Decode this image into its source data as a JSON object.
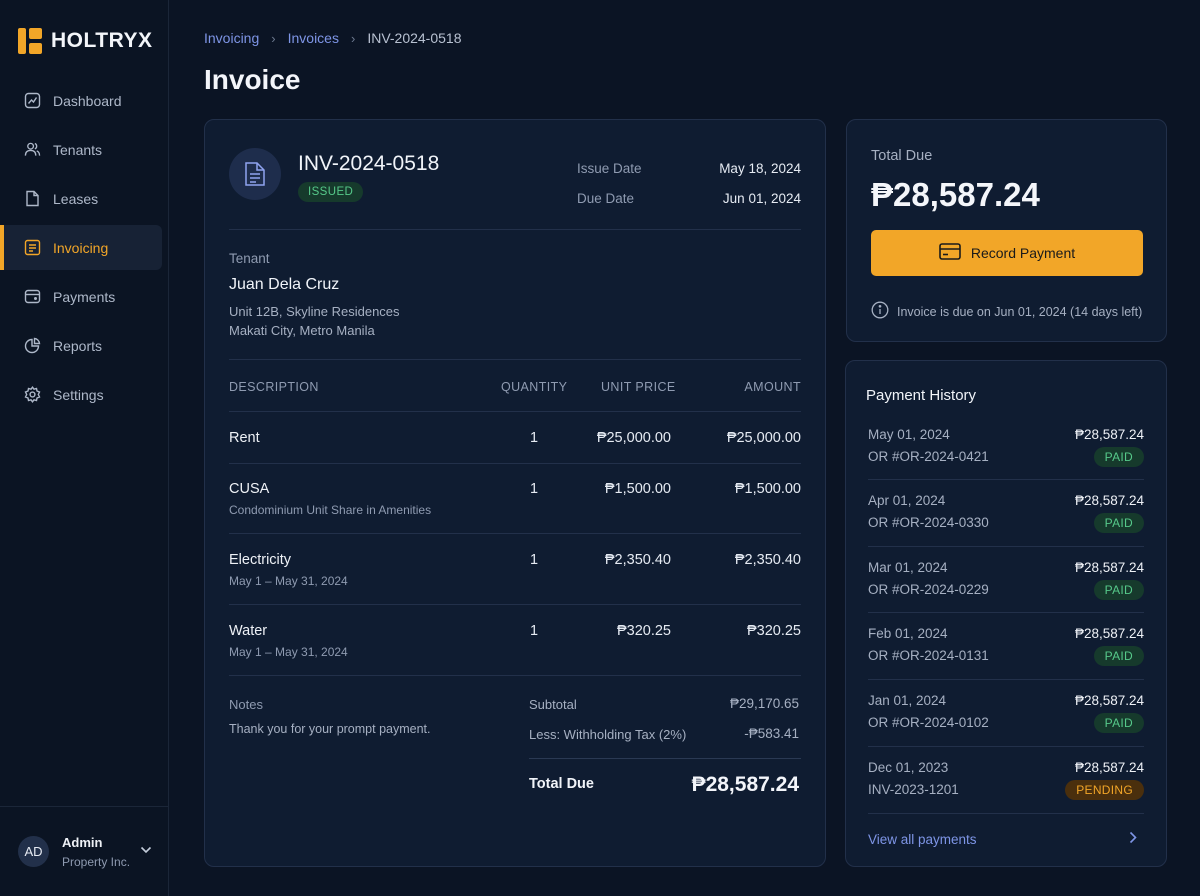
{
  "app": {
    "brand": "HOLTRYX"
  },
  "sidebar": {
    "items": [
      {
        "label": "Dashboard",
        "icon": "chart-icon"
      },
      {
        "label": "Tenants",
        "icon": "users-icon"
      },
      {
        "label": "Leases",
        "icon": "document-icon"
      },
      {
        "label": "Invoicing",
        "icon": "invoice-icon",
        "active": true
      },
      {
        "label": "Payments",
        "icon": "wallet-icon"
      },
      {
        "label": "Reports",
        "icon": "pie-chart-icon"
      },
      {
        "label": "Settings",
        "icon": "gear-icon"
      }
    ],
    "user": {
      "initials": "AD",
      "name": "Admin",
      "org": "Property Inc."
    }
  },
  "breadcrumb": {
    "items": [
      "Invoicing",
      "Invoices",
      "INV-2024-0518"
    ]
  },
  "page": {
    "title": "Invoice"
  },
  "invoice": {
    "number": "INV-2024-0518",
    "status": "ISSUED",
    "issue_date_label": "Issue Date",
    "issue_date": "May 18, 2024",
    "due_date_label": "Due Date",
    "due_date": "Jun 01, 2024",
    "tenant_label": "Tenant",
    "tenant_name": "Juan Dela Cruz",
    "address_line1": "Unit 12B, Skyline Residences",
    "address_line2": "Makati City, Metro Manila",
    "columns": [
      "DESCRIPTION",
      "QUANTITY",
      "UNIT PRICE",
      "AMOUNT"
    ],
    "line_items": [
      {
        "description": "Rent",
        "sub": "",
        "quantity": "1",
        "unit_price": "₱25,000.00",
        "amount": "₱25,000.00"
      },
      {
        "description": "CUSA",
        "sub": "Condominium Unit Share in Amenities",
        "quantity": "1",
        "unit_price": "₱1,500.00",
        "amount": "₱1,500.00"
      },
      {
        "description": "Electricity",
        "sub": "May 1 – May 31, 2024",
        "quantity": "1",
        "unit_price": "₱2,350.40",
        "amount": "₱2,350.40"
      },
      {
        "description": "Water",
        "sub": "May 1 – May 31, 2024",
        "quantity": "1",
        "unit_price": "₱320.25",
        "amount": "₱320.25"
      }
    ],
    "notes_label": "Notes",
    "notes": "Thank you for your prompt payment.",
    "subtotal_label": "Subtotal",
    "subtotal": "₱29,170.65",
    "withholding_label": "Less: Withholding Tax (2%)",
    "withholding": "-₱583.41",
    "total_label": "Total Due",
    "total": "₱28,587.24"
  },
  "due_panel": {
    "label": "Total Due",
    "amount": "₱28,587.24",
    "button_label": "Record Payment",
    "note": "Invoice is due on Jun 01, 2024 (14 days left)"
  },
  "history": {
    "title": "Payment History",
    "items": [
      {
        "date": "May 01, 2024",
        "ref": "OR #OR-2024-0421",
        "amount": "₱28,587.24",
        "status": "PAID"
      },
      {
        "date": "Apr 01, 2024",
        "ref": "OR #OR-2024-0330",
        "amount": "₱28,587.24",
        "status": "PAID"
      },
      {
        "date": "Mar 01, 2024",
        "ref": "OR #OR-2024-0229",
        "amount": "₱28,587.24",
        "status": "PAID"
      },
      {
        "date": "Feb 01, 2024",
        "ref": "OR #OR-2024-0131",
        "amount": "₱28,587.24",
        "status": "PAID"
      },
      {
        "date": "Jan 01, 2024",
        "ref": "OR #OR-2024-0102",
        "amount": "₱28,587.24",
        "status": "PAID"
      },
      {
        "date": "Dec 01, 2023",
        "ref": "INV-2023-1201",
        "amount": "₱28,587.24",
        "status": "PENDING"
      }
    ],
    "view_all_label": "View all payments"
  },
  "colors": {
    "accent": "#f2a628",
    "link": "#7e95e6",
    "paid": "#56c98a",
    "background": "#0b1424"
  }
}
